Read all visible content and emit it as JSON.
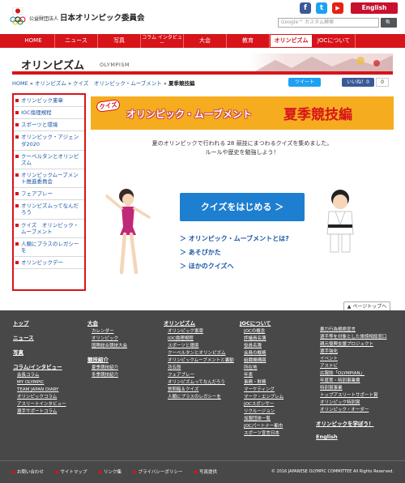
{
  "header": {
    "org_prefix": "公益財団法人",
    "org_name": "日本オリンピック委員会",
    "english": "English",
    "search_placeholder": "Google™ カスタム検索",
    "search_button": "🔍",
    "social": [
      "f",
      "t",
      "▶"
    ]
  },
  "nav": [
    "HOME",
    "ニュース",
    "写真",
    "コラム インタビュー",
    "大会",
    "教育",
    "オリンピズム",
    "JOCについて"
  ],
  "banner": {
    "title": "オリンピズム",
    "subtitle": "OLYMPISM"
  },
  "breadcrumb": {
    "items": [
      "HOME",
      "オリンピズム",
      "クイズ　オリンピック・ムーブメント"
    ],
    "current": "夏季競技編",
    "sep": "»"
  },
  "share": {
    "tweet": "ツイート",
    "like": "いいね！0",
    "like_count": "0"
  },
  "sidebar": [
    "オリンピック憲章",
    "IOC倫理規程",
    "スポーツと環境",
    "オリンピック・アジェンダ2020",
    "クーベルタンとオリンピズム",
    "オリンピックムーブメント推進委員会",
    "フェアプレー",
    "オリンピズムってなんだろう",
    "クイズ　オリンピック・ムーブメント",
    "人類にプラスのレガシーを",
    "オリンピックデー"
  ],
  "quiz": {
    "badge": "クイズ",
    "title": "オリンピック・ムーブメント",
    "subtitle": "夏季競技編",
    "intro1": "夏のオリンピックで行われる 28 競技にまつわるクイズを集めました。",
    "intro2": "ルールや歴史を勉強しよう！",
    "start": "クイズをはじめる ＞",
    "links": [
      "＞ オリンピック・ムーブメントとは?",
      "＞ あそびかた",
      "＞ ほかのクイズへ"
    ]
  },
  "pagetop": "▲ ページトップへ",
  "footer": {
    "col1": [
      {
        "h": "トップ"
      },
      {
        "h": "ニュース"
      },
      {
        "h": "写真"
      },
      {
        "h": "コラム/インタビュー",
        "items": [
          "会長コラム",
          "MY OLYMPIC",
          "TEAM JAPAN DIARY",
          "オリンピックコラム",
          "アスリートインタビュー",
          "選手サポートコラム"
        ]
      }
    ],
    "col2": [
      {
        "h": "大会",
        "items": [
          "カレンダー",
          "オリンピック",
          "国際総合競技大会"
        ]
      },
      {
        "h": "競技紹介",
        "items": [
          "夏季競技紹介",
          "冬季競技紹介"
        ]
      }
    ],
    "col3": [
      {
        "h": "オリンピズム",
        "items": [
          "オリンピック憲章",
          "IOC倫理規程",
          "スポーツと環境",
          "クーベルタンとオリンピズム",
          "オリンピックムーブメントと裏動",
          "功五郎",
          "フェアプレー",
          "オリンピズムってなんだろう",
          "質問箱＆クイズ",
          "人類にプラスのレガシーを"
        ]
      }
    ],
    "col4": [
      {
        "h": "JOCについて",
        "items": [
          "JOCの概念",
          "評議員名簿",
          "役員名簿",
          "会員の概略",
          "組織機構図",
          "所在地",
          "年表",
          "事務・財務",
          "マーケティング",
          "マーク・エンブレム",
          "JOCスポンサー",
          "リクルージョン",
          "加盟団体一覧",
          "JOCパートナー都市",
          "スポーツ宣言日本"
        ]
      }
    ],
    "col5": [
      {
        "items": [
          "暴力行為根絶宣言",
          "選手等を対象とした誹謗相談窓口",
          "親元復興支援プロジェクト",
          "選手強化",
          "イベント",
          "アスナビ",
          "広報誌「OLYMPIAN」",
          "年度実・特別事業費",
          "特別賞事業",
          "トップアスリートサポート賞",
          "オリンピック特別賞",
          "オリンピック・オーダー"
        ]
      },
      {
        "h": "オリンピックを学ぼう！"
      },
      {
        "h": "English"
      }
    ],
    "bottom": [
      "お問い合わせ",
      "サイトマップ",
      "リンク集",
      "プライバシーポリシー",
      "写真提供"
    ],
    "copyright": "© 2016 JAPANESE OLYMPIC COMMITTEE All Rights Reserved."
  },
  "colors": {
    "red": "#d7141a",
    "orange": "#f6ac1f",
    "blue": "#1e7fd0",
    "footer": "#484848"
  }
}
